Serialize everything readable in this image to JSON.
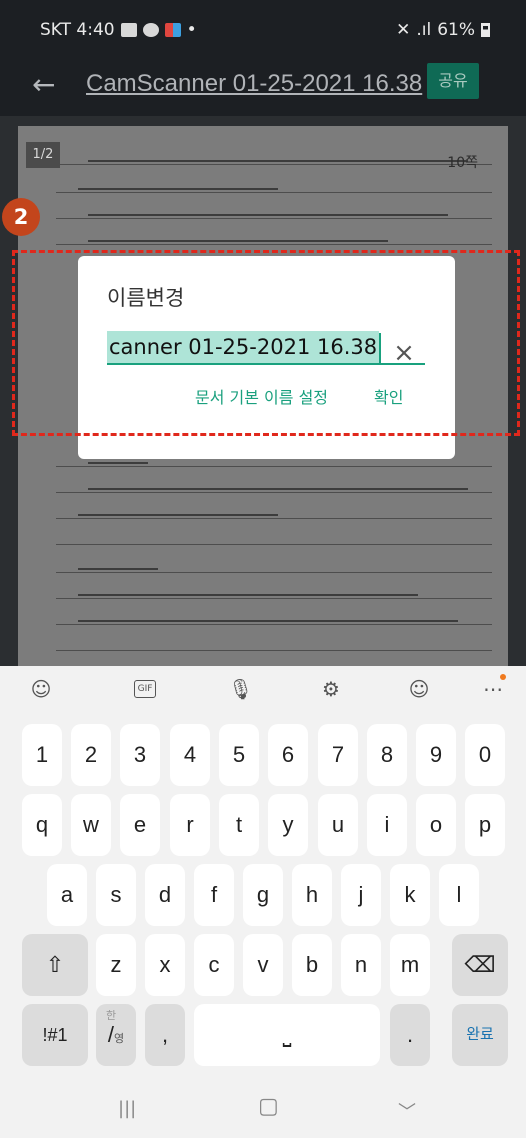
{
  "status_bar": {
    "carrier_time": "SKT 4:40",
    "battery": "61%"
  },
  "header": {
    "back_icon": "arrow-left-icon",
    "title": "CamScanner 01-25-2021 16.38",
    "share_label": "공유"
  },
  "document": {
    "page_indicator": "1/2",
    "page_number": "10쪽"
  },
  "annotation": {
    "step_number": "2"
  },
  "dialog": {
    "title": "이름변경",
    "input_value": "canner 01-25-2021 16.38",
    "clear_icon": "close-icon",
    "default_name_button": "문서 기본 이름 설정",
    "confirm_button": "확인"
  },
  "keyboard": {
    "toolbar_icons": [
      "sticker-icon",
      "gif-icon",
      "microphone-icon",
      "settings-icon",
      "emoji-icon",
      "more-icon"
    ],
    "row_numbers": [
      "1",
      "2",
      "3",
      "4",
      "5",
      "6",
      "7",
      "8",
      "9",
      "0"
    ],
    "row_qwerty": [
      "q",
      "w",
      "e",
      "r",
      "t",
      "y",
      "u",
      "i",
      "o",
      "p"
    ],
    "row_asdf": [
      "a",
      "s",
      "d",
      "f",
      "g",
      "h",
      "j",
      "k",
      "l"
    ],
    "row_zxcv": [
      "z",
      "x",
      "c",
      "v",
      "b",
      "n",
      "m"
    ],
    "symbols_key": "!#1",
    "lang_key_main": "/",
    "lang_key_top": "한",
    "lang_key_bottom": "영",
    "comma_key": ",",
    "period_key": ".",
    "done_key": "완료"
  },
  "nav_bar": {
    "recents": "|||",
    "home": "▢",
    "back": "﹀"
  },
  "colors": {
    "accent": "#19a17e",
    "highlight_border": "#e0281c",
    "badge": "#c3451c",
    "share_button": "#0f6a55"
  }
}
